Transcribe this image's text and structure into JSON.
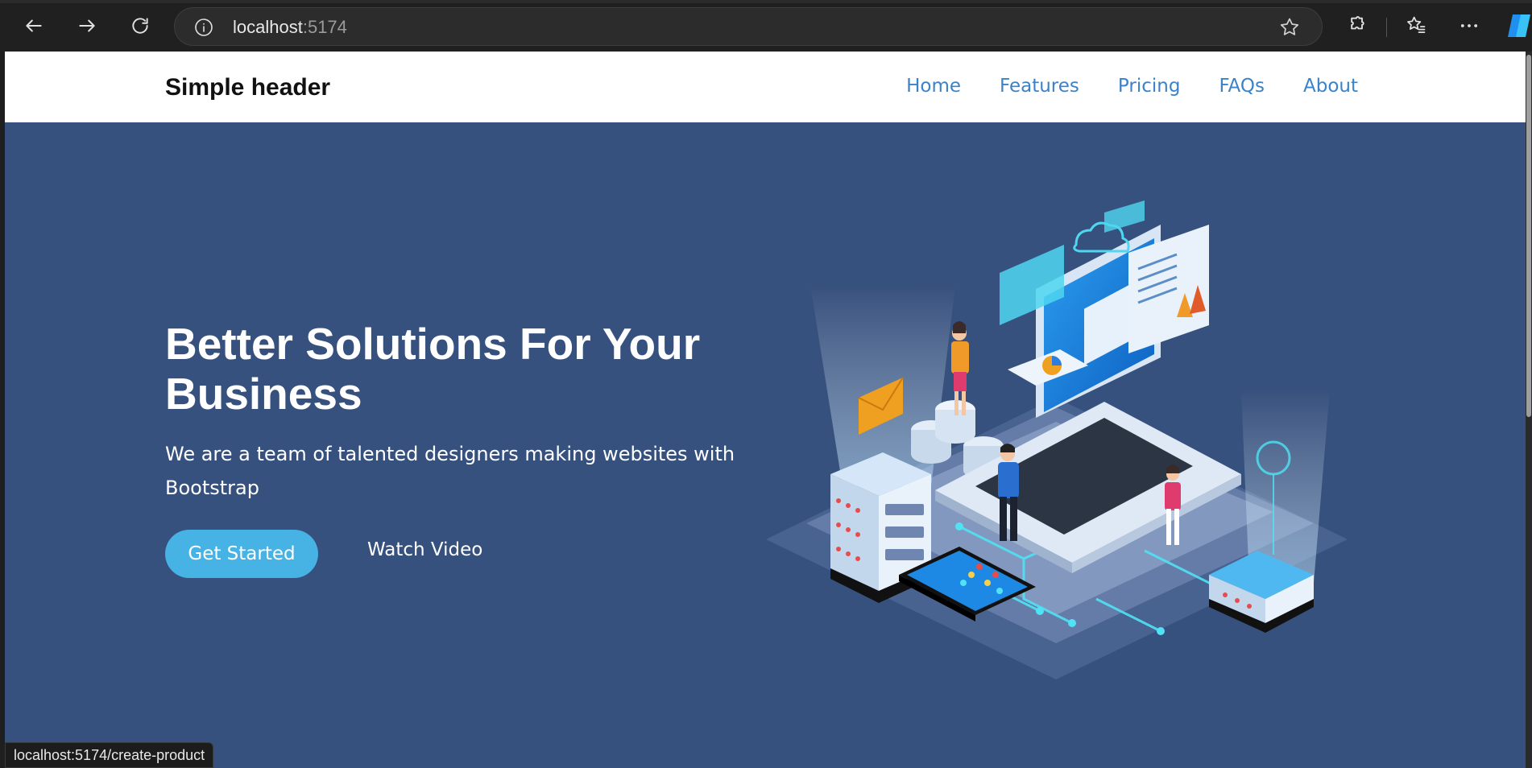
{
  "browser": {
    "url_host": "localhost",
    "url_port": ":5174",
    "status_url": "localhost:5174/create-product"
  },
  "site": {
    "brand": "Simple header",
    "nav": [
      "Home",
      "Features",
      "Pricing",
      "FAQs",
      "About"
    ]
  },
  "hero": {
    "title": "Better Solutions For Your Business",
    "subtitle": "We are a team of talented designers making websites with Bootstrap",
    "primary_button": "Get Started",
    "secondary_button": "Watch Video"
  },
  "colors": {
    "hero_bg": "#37517e",
    "accent": "#47b2e4",
    "nav_link": "#3b82c8"
  }
}
